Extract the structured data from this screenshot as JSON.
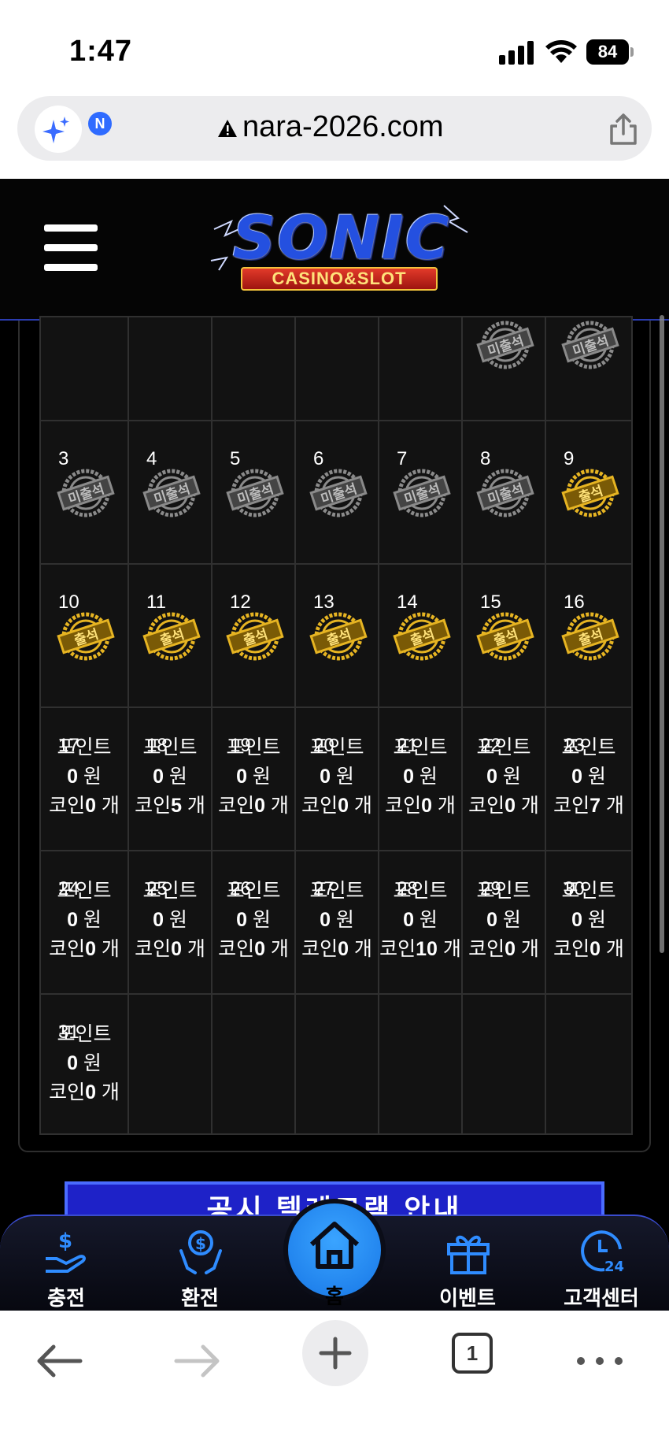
{
  "status_bar": {
    "time": "1:47",
    "battery": "84"
  },
  "browser": {
    "url": "nara-2026.com",
    "ai_badge": "N",
    "tab_count": "1"
  },
  "site": {
    "logo_main": "SONIC",
    "logo_sub": "CASINO&SLOT"
  },
  "calendar": {
    "stamp_absent": "미출석",
    "stamp_present": "출석",
    "reward": {
      "point_label": "포인트",
      "won_unit": "원",
      "coin_label": "코인",
      "count_unit": "개"
    },
    "rows": [
      [
        {
          "day": "",
          "status": "empty"
        },
        {
          "day": "",
          "status": "empty"
        },
        {
          "day": "",
          "status": "empty"
        },
        {
          "day": "",
          "status": "empty"
        },
        {
          "day": "",
          "status": "empty"
        },
        {
          "day": "",
          "status": "absent"
        },
        {
          "day": "",
          "status": "absent"
        }
      ],
      [
        {
          "day": "3",
          "status": "absent"
        },
        {
          "day": "4",
          "status": "absent"
        },
        {
          "day": "5",
          "status": "absent"
        },
        {
          "day": "6",
          "status": "absent"
        },
        {
          "day": "7",
          "status": "absent"
        },
        {
          "day": "8",
          "status": "absent"
        },
        {
          "day": "9",
          "status": "present"
        }
      ],
      [
        {
          "day": "10",
          "status": "present"
        },
        {
          "day": "11",
          "status": "present"
        },
        {
          "day": "12",
          "status": "present"
        },
        {
          "day": "13",
          "status": "present"
        },
        {
          "day": "14",
          "status": "present"
        },
        {
          "day": "15",
          "status": "present"
        },
        {
          "day": "16",
          "status": "present"
        }
      ],
      [
        {
          "day": "17",
          "status": "reward",
          "points": "0",
          "coins": "0"
        },
        {
          "day": "18",
          "status": "reward",
          "points": "0",
          "coins": "5"
        },
        {
          "day": "19",
          "status": "reward",
          "points": "0",
          "coins": "0"
        },
        {
          "day": "20",
          "status": "reward",
          "points": "0",
          "coins": "0"
        },
        {
          "day": "21",
          "status": "reward",
          "points": "0",
          "coins": "0"
        },
        {
          "day": "22",
          "status": "reward",
          "points": "0",
          "coins": "0"
        },
        {
          "day": "23",
          "status": "reward",
          "points": "0",
          "coins": "7"
        }
      ],
      [
        {
          "day": "24",
          "status": "reward",
          "points": "0",
          "coins": "0"
        },
        {
          "day": "25",
          "status": "reward",
          "points": "0",
          "coins": "0"
        },
        {
          "day": "26",
          "status": "reward",
          "points": "0",
          "coins": "0"
        },
        {
          "day": "27",
          "status": "reward",
          "points": "0",
          "coins": "0"
        },
        {
          "day": "28",
          "status": "reward",
          "points": "0",
          "coins": "10"
        },
        {
          "day": "29",
          "status": "reward",
          "points": "0",
          "coins": "0"
        },
        {
          "day": "30",
          "status": "reward",
          "points": "0",
          "coins": "0"
        }
      ],
      [
        {
          "day": "31",
          "status": "reward",
          "points": "0",
          "coins": "0"
        },
        {
          "day": "",
          "status": "empty"
        },
        {
          "day": "",
          "status": "empty"
        },
        {
          "day": "",
          "status": "empty"
        },
        {
          "day": "",
          "status": "empty"
        },
        {
          "day": "",
          "status": "empty"
        },
        {
          "day": "",
          "status": "empty"
        }
      ]
    ]
  },
  "banner": {
    "text": "공시 텔레그램 안내"
  },
  "nav": {
    "charge": "충전",
    "exchange": "환전",
    "home": "홈",
    "event": "이벤트",
    "support": "고객센터"
  }
}
